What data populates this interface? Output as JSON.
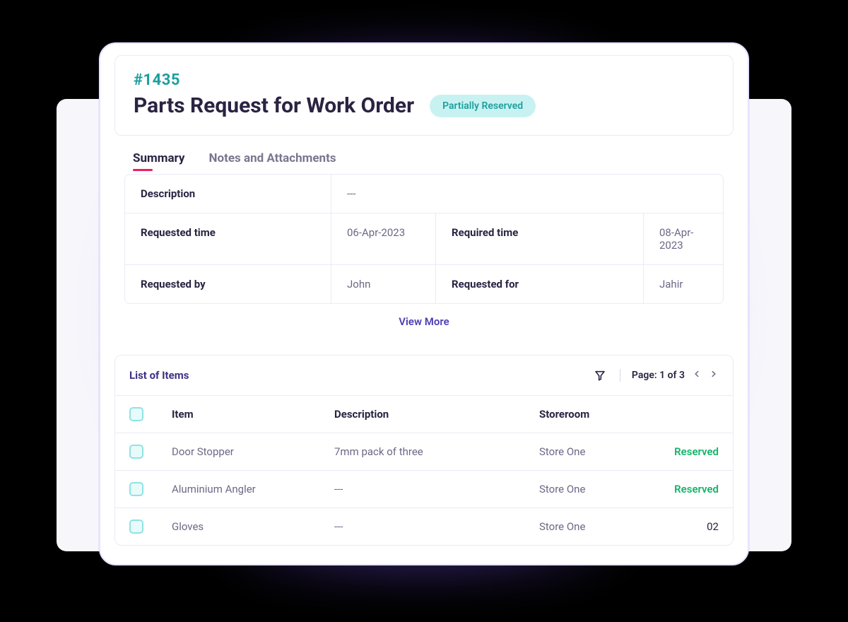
{
  "header": {
    "request_id": "#1435",
    "title": "Parts Request  for Work Order",
    "status": "Partially Reserved"
  },
  "tabs": [
    {
      "label": "Summary",
      "active": true
    },
    {
      "label": "Notes and Attachments",
      "active": false
    }
  ],
  "summary": {
    "description_label": "Description",
    "description_value": "---",
    "requested_time_label": "Requested time",
    "requested_time_value": "06-Apr-2023",
    "required_time_label": "Required time",
    "required_time_value": "08-Apr-2023",
    "requested_by_label": "Requested by",
    "requested_by_value": "John",
    "requested_for_label": "Requested for",
    "requested_for_value": "Jahir",
    "view_more": "View More"
  },
  "items": {
    "section_title": "List of Items",
    "pager_label": "Page: 1 of 3",
    "columns": {
      "item": "Item",
      "description": "Description",
      "storeroom": "Storeroom"
    },
    "rows": [
      {
        "item": "Door Stopper",
        "description": "7mm pack of three",
        "storeroom": "Store One",
        "status": "Reserved",
        "status_kind": "reserved"
      },
      {
        "item": "Aluminium Angler",
        "description": "---",
        "storeroom": "Store One",
        "status": "Reserved",
        "status_kind": "reserved"
      },
      {
        "item": "Gloves",
        "description": "---",
        "storeroom": "Store One",
        "status": "02",
        "status_kind": "qty"
      }
    ]
  }
}
